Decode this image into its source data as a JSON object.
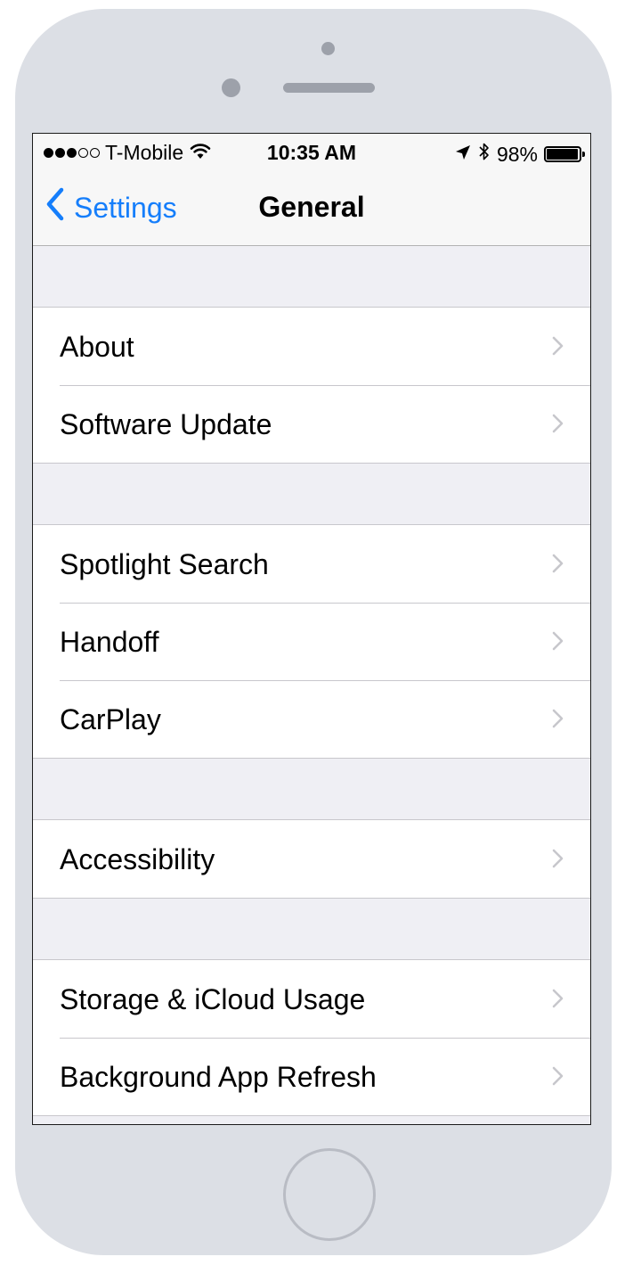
{
  "status_bar": {
    "carrier": "T-Mobile",
    "signal_bars_filled": 3,
    "signal_bars_total": 5,
    "time": "10:35 AM",
    "battery_percent_label": "98%",
    "battery_level": 0.98,
    "icons": [
      "wifi-icon",
      "location-arrow-icon",
      "bluetooth-icon",
      "battery-icon"
    ]
  },
  "nav": {
    "back_label": "Settings",
    "title": "General"
  },
  "groups": [
    {
      "items": [
        {
          "label": "About"
        },
        {
          "label": "Software Update"
        }
      ]
    },
    {
      "items": [
        {
          "label": "Spotlight Search"
        },
        {
          "label": "Handoff"
        },
        {
          "label": "CarPlay"
        }
      ]
    },
    {
      "items": [
        {
          "label": "Accessibility"
        }
      ]
    },
    {
      "items": [
        {
          "label": "Storage & iCloud Usage"
        },
        {
          "label": "Background App Refresh"
        }
      ]
    }
  ],
  "colors": {
    "accent": "#157efb",
    "grouped_background": "#efeff4",
    "separator": "#c8c7cc",
    "chevron": "#c7c7cc",
    "device_frame": "#dcdfe5"
  }
}
